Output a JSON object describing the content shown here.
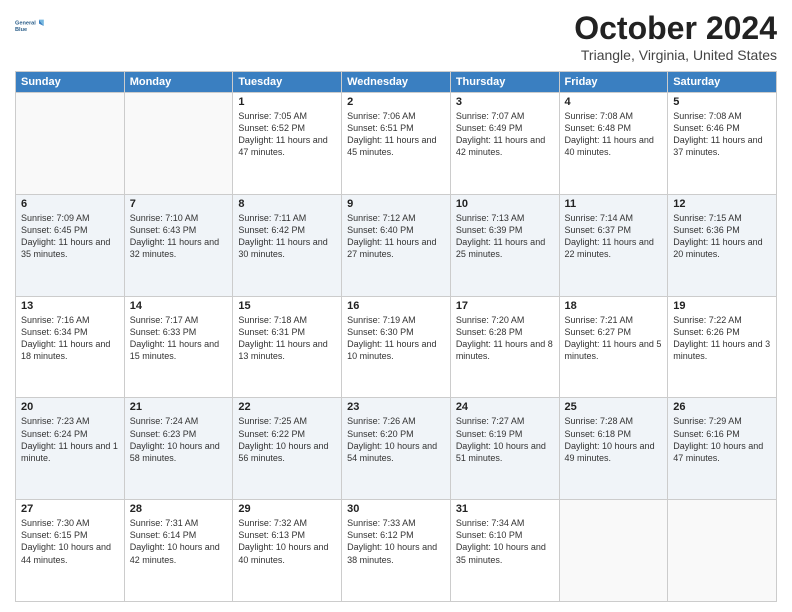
{
  "header": {
    "logo_line1": "General",
    "logo_line2": "Blue",
    "month": "October 2024",
    "location": "Triangle, Virginia, United States"
  },
  "days_of_week": [
    "Sunday",
    "Monday",
    "Tuesday",
    "Wednesday",
    "Thursday",
    "Friday",
    "Saturday"
  ],
  "weeks": [
    [
      {
        "day": "",
        "content": ""
      },
      {
        "day": "",
        "content": ""
      },
      {
        "day": "1",
        "content": "Sunrise: 7:05 AM\nSunset: 6:52 PM\nDaylight: 11 hours and 47 minutes."
      },
      {
        "day": "2",
        "content": "Sunrise: 7:06 AM\nSunset: 6:51 PM\nDaylight: 11 hours and 45 minutes."
      },
      {
        "day": "3",
        "content": "Sunrise: 7:07 AM\nSunset: 6:49 PM\nDaylight: 11 hours and 42 minutes."
      },
      {
        "day": "4",
        "content": "Sunrise: 7:08 AM\nSunset: 6:48 PM\nDaylight: 11 hours and 40 minutes."
      },
      {
        "day": "5",
        "content": "Sunrise: 7:08 AM\nSunset: 6:46 PM\nDaylight: 11 hours and 37 minutes."
      }
    ],
    [
      {
        "day": "6",
        "content": "Sunrise: 7:09 AM\nSunset: 6:45 PM\nDaylight: 11 hours and 35 minutes."
      },
      {
        "day": "7",
        "content": "Sunrise: 7:10 AM\nSunset: 6:43 PM\nDaylight: 11 hours and 32 minutes."
      },
      {
        "day": "8",
        "content": "Sunrise: 7:11 AM\nSunset: 6:42 PM\nDaylight: 11 hours and 30 minutes."
      },
      {
        "day": "9",
        "content": "Sunrise: 7:12 AM\nSunset: 6:40 PM\nDaylight: 11 hours and 27 minutes."
      },
      {
        "day": "10",
        "content": "Sunrise: 7:13 AM\nSunset: 6:39 PM\nDaylight: 11 hours and 25 minutes."
      },
      {
        "day": "11",
        "content": "Sunrise: 7:14 AM\nSunset: 6:37 PM\nDaylight: 11 hours and 22 minutes."
      },
      {
        "day": "12",
        "content": "Sunrise: 7:15 AM\nSunset: 6:36 PM\nDaylight: 11 hours and 20 minutes."
      }
    ],
    [
      {
        "day": "13",
        "content": "Sunrise: 7:16 AM\nSunset: 6:34 PM\nDaylight: 11 hours and 18 minutes."
      },
      {
        "day": "14",
        "content": "Sunrise: 7:17 AM\nSunset: 6:33 PM\nDaylight: 11 hours and 15 minutes."
      },
      {
        "day": "15",
        "content": "Sunrise: 7:18 AM\nSunset: 6:31 PM\nDaylight: 11 hours and 13 minutes."
      },
      {
        "day": "16",
        "content": "Sunrise: 7:19 AM\nSunset: 6:30 PM\nDaylight: 11 hours and 10 minutes."
      },
      {
        "day": "17",
        "content": "Sunrise: 7:20 AM\nSunset: 6:28 PM\nDaylight: 11 hours and 8 minutes."
      },
      {
        "day": "18",
        "content": "Sunrise: 7:21 AM\nSunset: 6:27 PM\nDaylight: 11 hours and 5 minutes."
      },
      {
        "day": "19",
        "content": "Sunrise: 7:22 AM\nSunset: 6:26 PM\nDaylight: 11 hours and 3 minutes."
      }
    ],
    [
      {
        "day": "20",
        "content": "Sunrise: 7:23 AM\nSunset: 6:24 PM\nDaylight: 11 hours and 1 minute."
      },
      {
        "day": "21",
        "content": "Sunrise: 7:24 AM\nSunset: 6:23 PM\nDaylight: 10 hours and 58 minutes."
      },
      {
        "day": "22",
        "content": "Sunrise: 7:25 AM\nSunset: 6:22 PM\nDaylight: 10 hours and 56 minutes."
      },
      {
        "day": "23",
        "content": "Sunrise: 7:26 AM\nSunset: 6:20 PM\nDaylight: 10 hours and 54 minutes."
      },
      {
        "day": "24",
        "content": "Sunrise: 7:27 AM\nSunset: 6:19 PM\nDaylight: 10 hours and 51 minutes."
      },
      {
        "day": "25",
        "content": "Sunrise: 7:28 AM\nSunset: 6:18 PM\nDaylight: 10 hours and 49 minutes."
      },
      {
        "day": "26",
        "content": "Sunrise: 7:29 AM\nSunset: 6:16 PM\nDaylight: 10 hours and 47 minutes."
      }
    ],
    [
      {
        "day": "27",
        "content": "Sunrise: 7:30 AM\nSunset: 6:15 PM\nDaylight: 10 hours and 44 minutes."
      },
      {
        "day": "28",
        "content": "Sunrise: 7:31 AM\nSunset: 6:14 PM\nDaylight: 10 hours and 42 minutes."
      },
      {
        "day": "29",
        "content": "Sunrise: 7:32 AM\nSunset: 6:13 PM\nDaylight: 10 hours and 40 minutes."
      },
      {
        "day": "30",
        "content": "Sunrise: 7:33 AM\nSunset: 6:12 PM\nDaylight: 10 hours and 38 minutes."
      },
      {
        "day": "31",
        "content": "Sunrise: 7:34 AM\nSunset: 6:10 PM\nDaylight: 10 hours and 35 minutes."
      },
      {
        "day": "",
        "content": ""
      },
      {
        "day": "",
        "content": ""
      }
    ]
  ]
}
